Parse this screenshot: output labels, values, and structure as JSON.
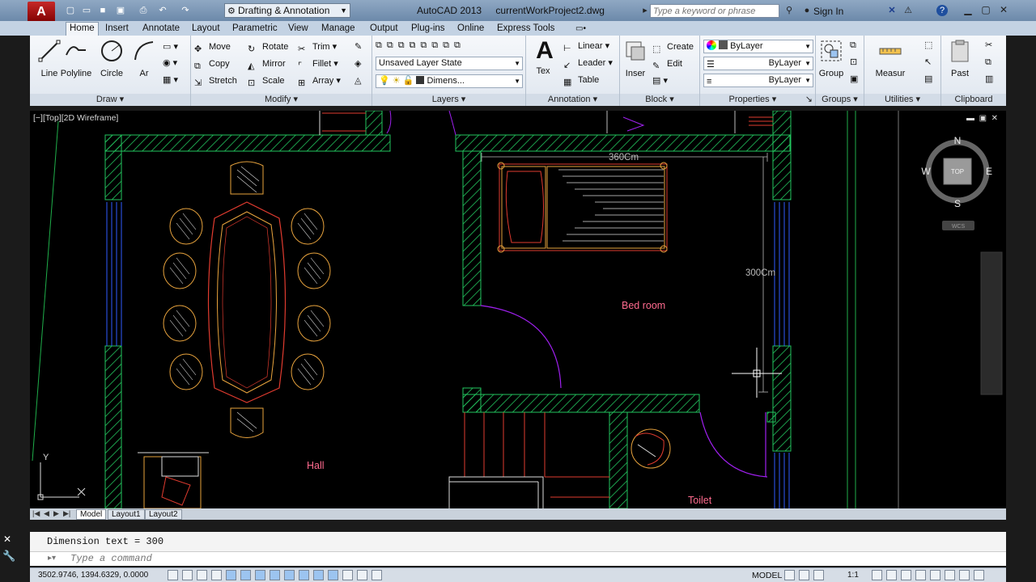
{
  "titlebar": {
    "app_name": "AutoCAD 2013",
    "file_name": "currentWorkProject2.dwg",
    "workspace": "Drafting & Annotation",
    "search_placeholder": "Type a keyword or phrase",
    "signin": "Sign In"
  },
  "ribbon_tabs": [
    "Home",
    "Insert",
    "Annotate",
    "Layout",
    "Parametric",
    "View",
    "Manage",
    "Output",
    "Plug-ins",
    "Online",
    "Express Tools"
  ],
  "panels": {
    "draw": {
      "title": "Draw",
      "tools": [
        "Line",
        "Polyline",
        "Circle",
        "Ar"
      ]
    },
    "modify": {
      "title": "Modify",
      "tools": [
        "Move",
        "Rotate",
        "Trim",
        "Copy",
        "Mirror",
        "Fillet",
        "Stretch",
        "Scale",
        "Array"
      ]
    },
    "layers": {
      "title": "Layers",
      "layer_state": "Unsaved Layer State",
      "current_layer": "Dimens..."
    },
    "annotation": {
      "title": "Annotation",
      "big": "Tex",
      "tools": [
        "Linear",
        "Leader",
        "Table"
      ]
    },
    "block": {
      "title": "Block",
      "big": "Inser",
      "tools": [
        "Create",
        "Edit"
      ]
    },
    "properties": {
      "title": "Properties",
      "color": "ByLayer",
      "linetype": "ByLayer",
      "lineweight": "ByLayer"
    },
    "groups": {
      "title": "Groups",
      "big": "Group"
    },
    "utilities": {
      "title": "Utilities",
      "big": "Measur"
    },
    "clipboard": {
      "title": "Clipboard",
      "big": "Past"
    }
  },
  "drawing": {
    "viewport_label": "[−][Top][2D Wireframe]",
    "room_labels": [
      "Bed room",
      "Hall",
      "Toilet"
    ],
    "dimensions": [
      "360Cm",
      "300Cm"
    ],
    "viewcube": {
      "top": "TOP",
      "north": "N",
      "south": "S",
      "east": "E",
      "west": "W",
      "ucs": "WCS"
    },
    "ucs_axis": "Y"
  },
  "layout_tabs": [
    "Model",
    "Layout1",
    "Layout2"
  ],
  "command": {
    "history": "Dimension text = 300",
    "placeholder": "Type a command"
  },
  "status": {
    "coords": "3502.9746, 1394.6329, 0.0000",
    "space": "MODEL",
    "scale": "1:1"
  },
  "colors": {
    "walls": "#22c55e",
    "furniture_red": "#e03b2f",
    "furniture_orange": "#e8a33d",
    "door_arc": "#a020f0",
    "room_label": "#ff6b8f",
    "window_blue": "#2f5bff"
  }
}
